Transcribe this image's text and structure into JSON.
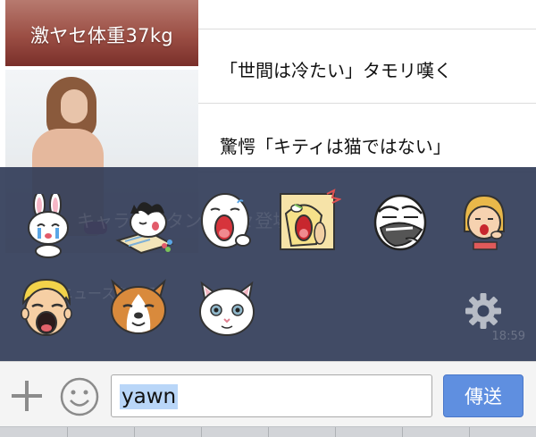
{
  "news": {
    "items": [
      {
        "caption": "激ヤセ体重37kg",
        "title": ""
      },
      {
        "caption": "",
        "title": "「世間は冷たい」タモリ嘆く"
      },
      {
        "caption": "",
        "title": "驚愕「キティは猫ではない」"
      }
    ]
  },
  "sticker_panel": {
    "ghost_text": "キャラがスタンプ続々登場",
    "ghost_link": "ニュースを見る",
    "ghost_time": "18:59",
    "stickers": [
      {
        "icon": "crying-bunny-sticker"
      },
      {
        "icon": "sleepy-cat-reading-sticker"
      },
      {
        "icon": "yawning-moon-face-sticker"
      },
      {
        "icon": "yawning-yellow-character-sticker"
      },
      {
        "icon": "yawning-troll-face-sticker"
      },
      {
        "icon": "yawning-girl-sticker"
      },
      {
        "icon": "yawning-blond-boy-sticker"
      },
      {
        "icon": "yawning-shiba-dog-sticker"
      },
      {
        "icon": "yawning-white-cat-sticker"
      }
    ],
    "settings_icon": "gear-icon"
  },
  "input_bar": {
    "plus_icon": "plus-icon",
    "emoji_icon": "smiley-icon",
    "message_value": "yawn",
    "send_label": "傳送"
  },
  "colors": {
    "panel": "#313c58",
    "send_button": "#5f8fe0",
    "selection": "#b9d6f8"
  }
}
